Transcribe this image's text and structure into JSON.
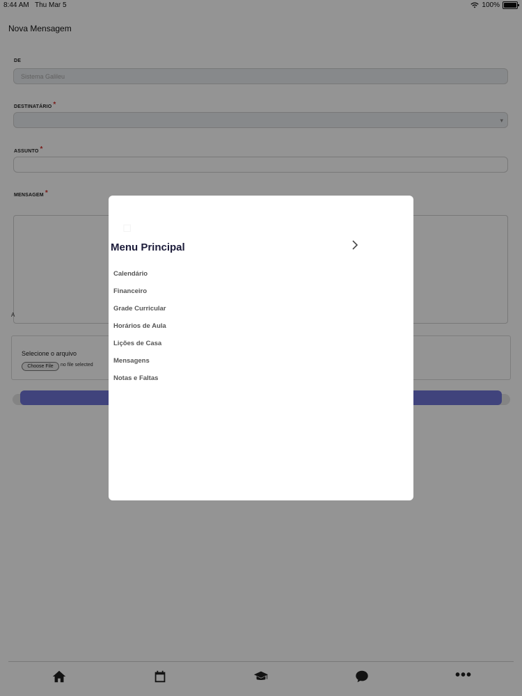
{
  "status_bar": {
    "time": "8:44 AM",
    "date": "Thu Mar 5",
    "battery": "100%",
    "wifi_icon": "wifi-icon"
  },
  "page": {
    "title": "Nova Mensagem"
  },
  "form": {
    "from_label": "DE",
    "from_value": "Sistema Galileu",
    "to_label": "DESTINATÁRIO",
    "subject_label": "ASSUNTO",
    "message_label": "MENSAGEM",
    "required_mark": "*",
    "tiny_letter": "A",
    "file_label": "Selecione o arquivo",
    "choose_file": "Choose File",
    "no_file": "no file selected"
  },
  "modal": {
    "title": "Menu Principal",
    "items": [
      "Calendário",
      "Financeiro",
      "Grade Curricular",
      "Horários de Aula",
      "Lições de Casa",
      "Mensagens",
      "Notas e Faltas"
    ]
  },
  "bottom_nav": {
    "icons": [
      "home-icon",
      "calendar-icon",
      "graduation-cap-icon",
      "chat-bubble-icon",
      "more-icon"
    ],
    "more": "•••"
  },
  "colors": {
    "accent": "#6f74d6",
    "required": "#d0312d",
    "overlay": "rgba(0,0,0,0.42)"
  }
}
